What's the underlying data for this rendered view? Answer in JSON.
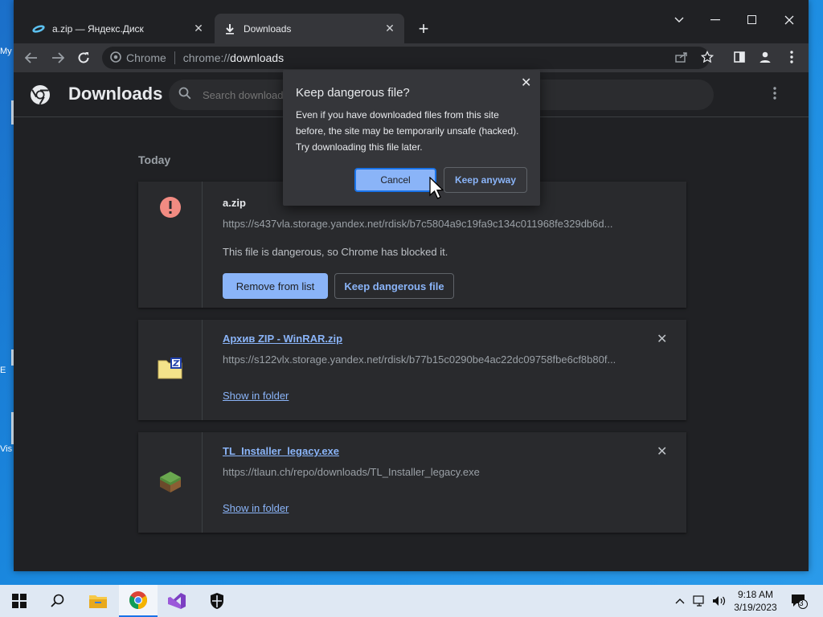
{
  "desktop": {
    "fragments": [
      "My",
      "E",
      "Vis"
    ]
  },
  "tabs": [
    {
      "title": "a.zip — Яндекс.Диск",
      "icon": "yandex-disk-icon"
    },
    {
      "title": "Downloads",
      "icon": "download-icon"
    }
  ],
  "omnibox": {
    "chip": "Chrome",
    "scheme": "chrome://",
    "host": "downloads"
  },
  "page": {
    "title": "Downloads",
    "search_placeholder": "Search downloads",
    "section": "Today"
  },
  "downloads": [
    {
      "name": "a.zip",
      "url": "https://s437vla.storage.yandex.net/rdisk/b7c5804a9c19fa9c134c011968fe329db6d...",
      "message": "This file is dangerous, so Chrome has blocked it.",
      "remove_label": "Remove from list",
      "keep_label": "Keep dangerous file",
      "status_color": "#f28b82"
    },
    {
      "name": "Архив ZIP - WinRAR.zip",
      "url": "https://s122vlx.storage.yandex.net/rdisk/b77b15c0290be4ac22dc09758fbe6cf8b80f...",
      "action": "Show in folder"
    },
    {
      "name": "TL_Installer_legacy.exe",
      "url": "https://tlaun.ch/repo/downloads/TL_Installer_legacy.exe",
      "action": "Show in folder"
    }
  ],
  "dialog": {
    "title": "Keep dangerous file?",
    "body": "Even if you have downloaded files from this site before, the site may be temporarily unsafe (hacked). Try downloading this file later.",
    "cancel": "Cancel",
    "keep": "Keep anyway"
  },
  "taskbar": {
    "time": "9:18 AM",
    "date": "3/19/2023",
    "notifications": "3"
  },
  "colors": {
    "accent": "#8ab4f8",
    "page_bg": "#202124",
    "card_bg": "#292a2d",
    "danger": "#f28b82"
  }
}
